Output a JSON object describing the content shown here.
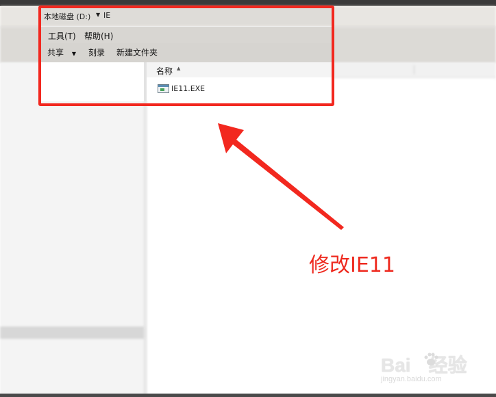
{
  "address_bar": {
    "drive": "本地磁盘 (D:)",
    "folder": "IE"
  },
  "menu": {
    "tools": "工具(T)",
    "help": "帮助(H)"
  },
  "commands": {
    "share": "共享",
    "burn": "刻录",
    "new_folder": "新建文件夹"
  },
  "file_list": {
    "column_name": "名称",
    "files": [
      {
        "name": "IE11.EXE",
        "icon": "exe-icon"
      }
    ]
  },
  "annotation": {
    "text": "修改IE11",
    "color": "#f2281f"
  },
  "watermark": {
    "logo": "Bai",
    "logo_tail": "经验",
    "url": "jingyan.baidu.com"
  }
}
